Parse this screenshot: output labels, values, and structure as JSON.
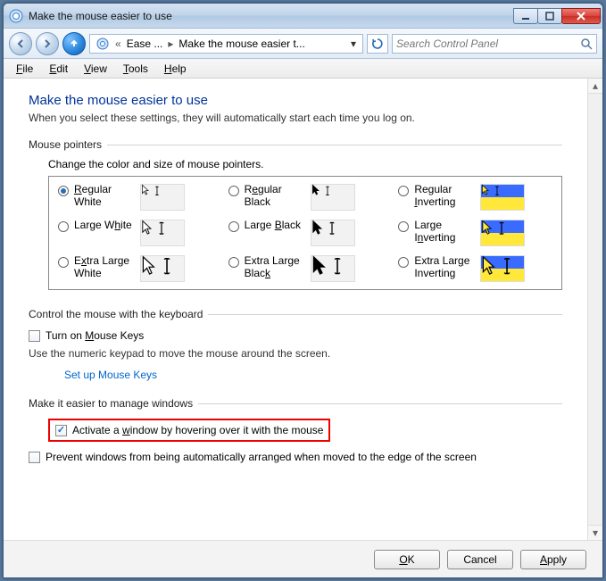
{
  "window": {
    "title": "Make the mouse easier to use"
  },
  "nav": {
    "crumb1": "Ease ...",
    "crumb2": "Make the mouse easier t...",
    "search_placeholder": "Search Control Panel"
  },
  "menu": {
    "file": "File",
    "edit": "Edit",
    "view": "View",
    "tools": "Tools",
    "help": "Help"
  },
  "page": {
    "title": "Make the mouse easier to use",
    "subtitle": "When you select these settings, they will automatically start each time you log on."
  },
  "pointers": {
    "group": "Mouse pointers",
    "caption": "Change the color and size of mouse pointers.",
    "options": [
      {
        "label": "Regular White",
        "selected": true,
        "size": "s",
        "variant": "white"
      },
      {
        "label": "Regular Black",
        "selected": false,
        "size": "s",
        "variant": "black"
      },
      {
        "label": "Regular Inverting",
        "selected": false,
        "size": "s",
        "variant": "inv"
      },
      {
        "label": "Large White",
        "selected": false,
        "size": "m",
        "variant": "white"
      },
      {
        "label": "Large Black",
        "selected": false,
        "size": "m",
        "variant": "black"
      },
      {
        "label": "Large Inverting",
        "selected": false,
        "size": "m",
        "variant": "inv"
      },
      {
        "label": "Extra Large White",
        "selected": false,
        "size": "l",
        "variant": "white"
      },
      {
        "label": "Extra Large Black",
        "selected": false,
        "size": "l",
        "variant": "black"
      },
      {
        "label": "Extra Large Inverting",
        "selected": false,
        "size": "l",
        "variant": "inv"
      }
    ]
  },
  "keyboard": {
    "group": "Control the mouse with the keyboard",
    "mousekeys_label": "Turn on Mouse Keys",
    "mousekeys_checked": false,
    "mousekeys_desc": "Use the numeric keypad to move the mouse around the screen.",
    "setup_link": "Set up Mouse Keys"
  },
  "windows": {
    "group": "Make it easier to manage windows",
    "activate_label": "Activate a window by hovering over it with the mouse",
    "activate_checked": true,
    "prevent_label": "Prevent windows from being automatically arranged when moved to the edge of the screen",
    "prevent_checked": false
  },
  "footer": {
    "ok": "OK",
    "cancel": "Cancel",
    "apply": "Apply"
  }
}
